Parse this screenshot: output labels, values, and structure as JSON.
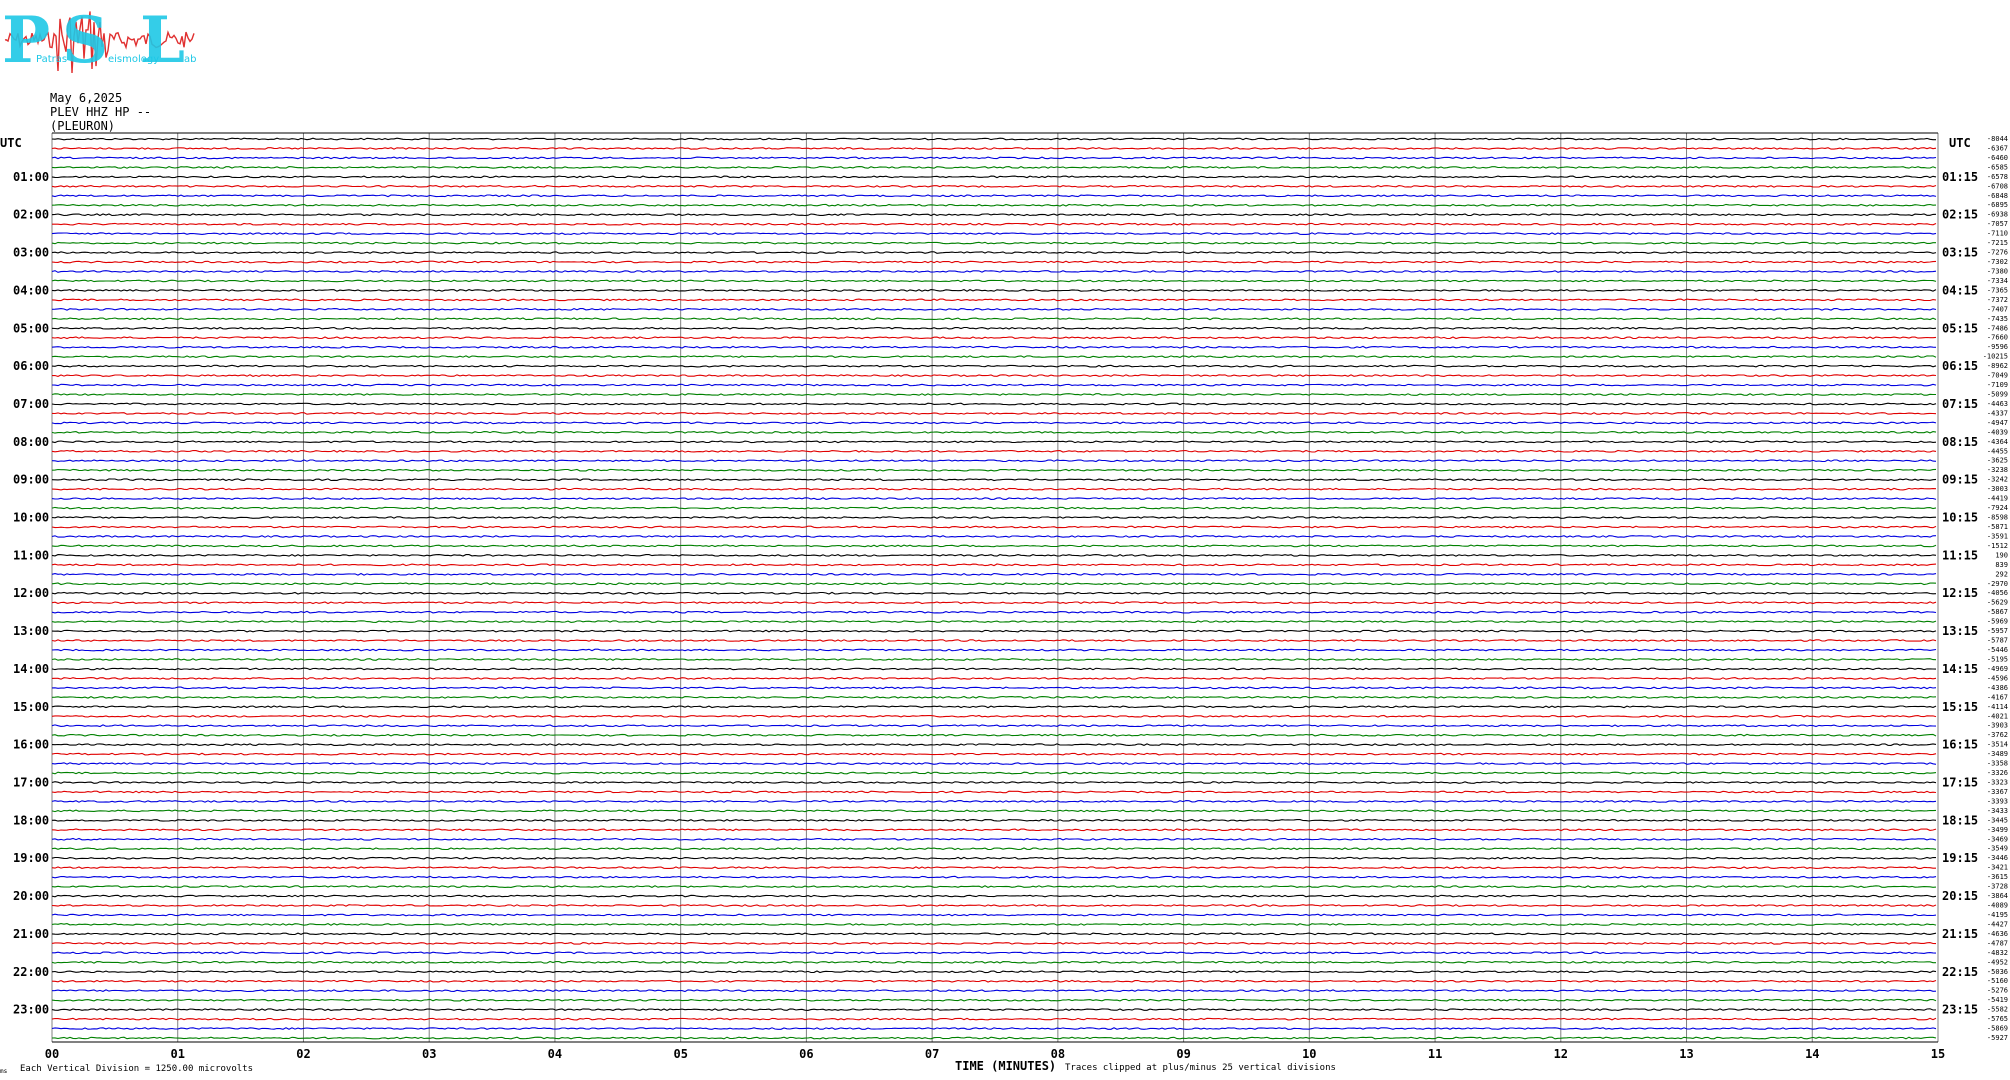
{
  "logo": {
    "letters": [
      "P",
      "S",
      "L"
    ],
    "small_text": [
      "Patras",
      "eismology",
      "ab"
    ],
    "colors": {
      "letters": "#1ec8e6",
      "trace": "#e03030"
    }
  },
  "header": {
    "date": "May 6,2025",
    "station": "PLEV HHZ HP --",
    "location": "(PLEURON)"
  },
  "chart_data": {
    "type": "line",
    "title": "",
    "left_axis_label": "UTC",
    "right_axis_label": "UTC",
    "xlabel": "TIME (MINUTES)",
    "x_ticks": [
      "00",
      "01",
      "02",
      "03",
      "04",
      "05",
      "06",
      "07",
      "08",
      "09",
      "10",
      "11",
      "12",
      "13",
      "14",
      "15"
    ],
    "xlim": [
      0,
      15
    ],
    "grid": true,
    "left_hour_labels": [
      "01:00",
      "02:00",
      "03:00",
      "04:00",
      "05:00",
      "06:00",
      "07:00",
      "08:00",
      "09:00",
      "10:00",
      "11:00",
      "12:00",
      "13:00",
      "14:00",
      "15:00",
      "16:00",
      "17:00",
      "18:00",
      "19:00",
      "20:00",
      "21:00",
      "22:00",
      "23:00"
    ],
    "right_hour_labels": [
      "01:15",
      "02:15",
      "03:15",
      "04:15",
      "05:15",
      "06:15",
      "07:15",
      "08:15",
      "09:15",
      "10:15",
      "11:15",
      "12:15",
      "13:15",
      "14:15",
      "15:15",
      "16:15",
      "17:15",
      "18:15",
      "19:15",
      "20:15",
      "21:15",
      "22:15",
      "23:15"
    ],
    "trace_colors": [
      "#000000",
      "#e00000",
      "#0000e0",
      "#008000"
    ],
    "row_offsets": [
      -8044,
      -6367,
      -6460,
      -6585,
      -6578,
      -6708,
      -6848,
      -6895,
      -6938,
      -7057,
      -7110,
      -7215,
      -7276,
      -7302,
      -7380,
      -7334,
      -7365,
      -7372,
      -7407,
      -7435,
      -7486,
      -7660,
      -9596,
      -10215,
      -8962,
      -7049,
      -7109,
      -5099,
      -4463,
      -4337,
      -4947,
      -4039,
      -4364,
      -4455,
      -3625,
      -3238,
      -3242,
      -3003,
      -4419,
      -7924,
      -8598,
      -5871,
      -3591,
      -1512,
      190,
      839,
      292,
      -2970,
      -4056,
      -5629,
      -5867,
      -5969,
      -5957,
      -5787,
      -5446,
      -5195,
      -4969,
      -4596,
      -4386,
      -4167,
      -4114,
      -4021,
      -3903,
      -3762,
      -3514,
      -3489,
      -3358,
      -3326,
      -3323,
      -3367,
      -3393,
      -3433,
      -3445,
      -3499,
      -3469,
      -3549,
      -3446,
      -3421,
      -3615,
      -3728,
      -3864,
      -4089,
      -4195,
      -4427,
      -4636,
      -4787,
      -4832,
      -4952,
      -5036,
      -5160,
      -5276,
      -5419,
      -5582,
      -5765,
      -5869,
      -5927
    ],
    "footer_left": "Each Vertical Division = 1250.00 microvolts",
    "footer_right": "Traces clipped at plus/minus 25 vertical divisions",
    "footer_mark": "ms"
  }
}
